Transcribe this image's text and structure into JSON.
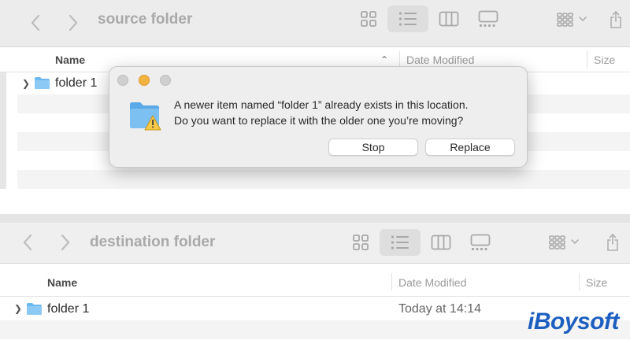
{
  "source_window": {
    "title": "source folder",
    "columns": {
      "name": "Name",
      "date": "Date Modified",
      "size": "Size"
    },
    "rows": [
      {
        "name": "folder 1",
        "date": ""
      }
    ]
  },
  "destination_window": {
    "title": "destination folder",
    "columns": {
      "name": "Name",
      "date": "Date Modified",
      "size": "Size"
    },
    "rows": [
      {
        "name": "folder 1",
        "date": "Today at 14:14"
      }
    ]
  },
  "dialog": {
    "line1": "A newer item named “folder 1” already exists in this location.",
    "line2": "Do you want to replace it with the older one you’re moving?",
    "stop_label": "Stop",
    "replace_label": "Replace"
  },
  "watermark": {
    "text": "iBoysoft"
  },
  "colors": {
    "folder": "#6cb8f0",
    "accent_brand": "#1d5fbf",
    "traffic_yellow": "#f4b33e"
  },
  "icons": [
    "back-icon",
    "forward-icon",
    "icon-view-icon",
    "list-view-icon",
    "column-view-icon",
    "gallery-view-icon",
    "group-icon",
    "share-icon",
    "folder-icon",
    "warning-icon"
  ]
}
